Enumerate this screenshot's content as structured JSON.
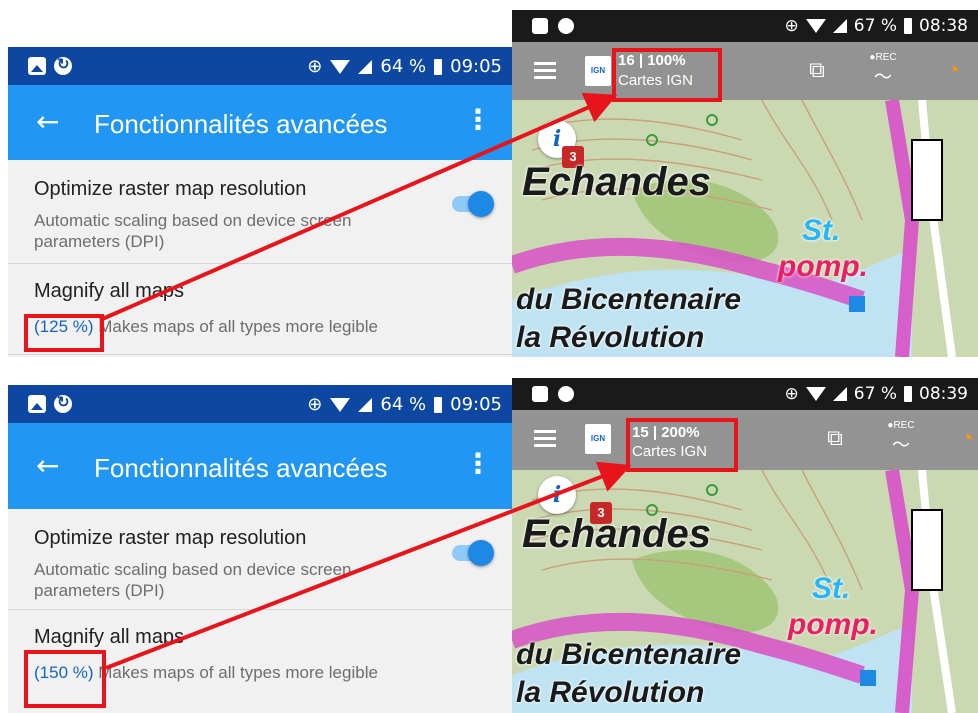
{
  "panels": [
    {
      "status": {
        "time": "09:05",
        "battery": "64 %"
      },
      "title": "Fonctionnalités avancées",
      "back": "←",
      "more": "⋮",
      "optimize": {
        "title": "Optimize raster map resolution",
        "subtitle": "Automatic scaling based on device screen parameters (DPI)",
        "enabled": true
      },
      "magnify": {
        "title": "Magnify all maps",
        "percent": "(125 %)",
        "desc": " Makes maps of all types more legible"
      }
    },
    {
      "status": {
        "time": "09:05",
        "battery": "64 %"
      },
      "title": "Fonctionnalités avancées",
      "back": "←",
      "more": "⋮",
      "optimize": {
        "title": "Optimize raster map resolution",
        "subtitle": "Automatic scaling based on device screen parameters (DPI)",
        "enabled": true
      },
      "magnify": {
        "title": "Magnify all maps",
        "percent": "(150 %)",
        "desc": " Makes maps of all types more legible"
      }
    }
  ],
  "maps": [
    {
      "status": {
        "time": "08:38",
        "battery": "67 %"
      },
      "zoom_scale": "16 | 100%",
      "layer": "Cartes IGN",
      "ign_logo": "IGN",
      "info": "i",
      "badge": "3",
      "rec": "●REC",
      "labels": {
        "place": "Echandes",
        "st": "St.",
        "pomp": "pomp.",
        "bicentenaire": "du Bicentenaire",
        "revolution": "la Révolution"
      }
    },
    {
      "status": {
        "time": "08:39",
        "battery": "67 %"
      },
      "zoom_scale": "15 | 200%",
      "layer": "Cartes IGN",
      "ign_logo": "IGN",
      "info": "i",
      "badge": "3",
      "rec": "●REC",
      "labels": {
        "place": "Echandes",
        "st": "St.",
        "pomp": "pomp.",
        "bicentenaire": "du Bicentenaire",
        "revolution": "la Révolution"
      }
    }
  ],
  "colors": {
    "toolbar": "#2196f3",
    "statusbar": "#0d47a1",
    "highlight": "#e8141c",
    "accent": "#1565c0"
  }
}
